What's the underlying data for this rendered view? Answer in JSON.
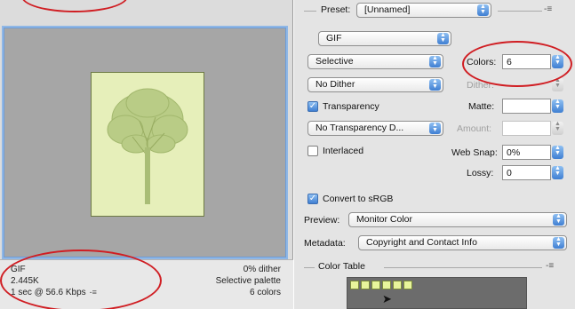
{
  "preview": {
    "info_format": "GIF",
    "info_size": "2.445K",
    "info_time": "1 sec @ 56.6 Kbps",
    "info_dither": "0% dither",
    "info_palette": "Selective palette",
    "info_colors": "6 colors",
    "menu_glyph": "-≡"
  },
  "settings": {
    "preset_label": "Preset:",
    "preset_value": "[Unnamed]",
    "panel_menu": "-≡",
    "format_value": "GIF",
    "reduction_value": "Selective",
    "colors_label": "Colors:",
    "colors_value": "6",
    "dither_value": "No Dither",
    "dither_label": "Dither:",
    "transparency_label": "Transparency",
    "transparency_checked": true,
    "matte_label": "Matte:",
    "transparency_dither_value": "No Transparency D...",
    "amount_label": "Amount:",
    "interlaced_label": "Interlaced",
    "interlaced_checked": false,
    "web_snap_label": "Web Snap:",
    "web_snap_value": "0%",
    "lossy_label": "Lossy:",
    "lossy_value": "0",
    "convert_label": "Convert to sRGB",
    "convert_checked": true,
    "preview_label": "Preview:",
    "preview_value": "Monitor Color",
    "metadata_label": "Metadata:",
    "metadata_value": "Copyright and Contact Info"
  },
  "color_table": {
    "title": "Color Table",
    "panel_menu": "-≡",
    "swatch_count": 6,
    "swatch_color": "#e8f59b"
  },
  "colors": {
    "accent": "#3f7fd2",
    "annotation": "#d01e23",
    "image_bg": "#e6efba",
    "tree": "#9fb46a"
  }
}
